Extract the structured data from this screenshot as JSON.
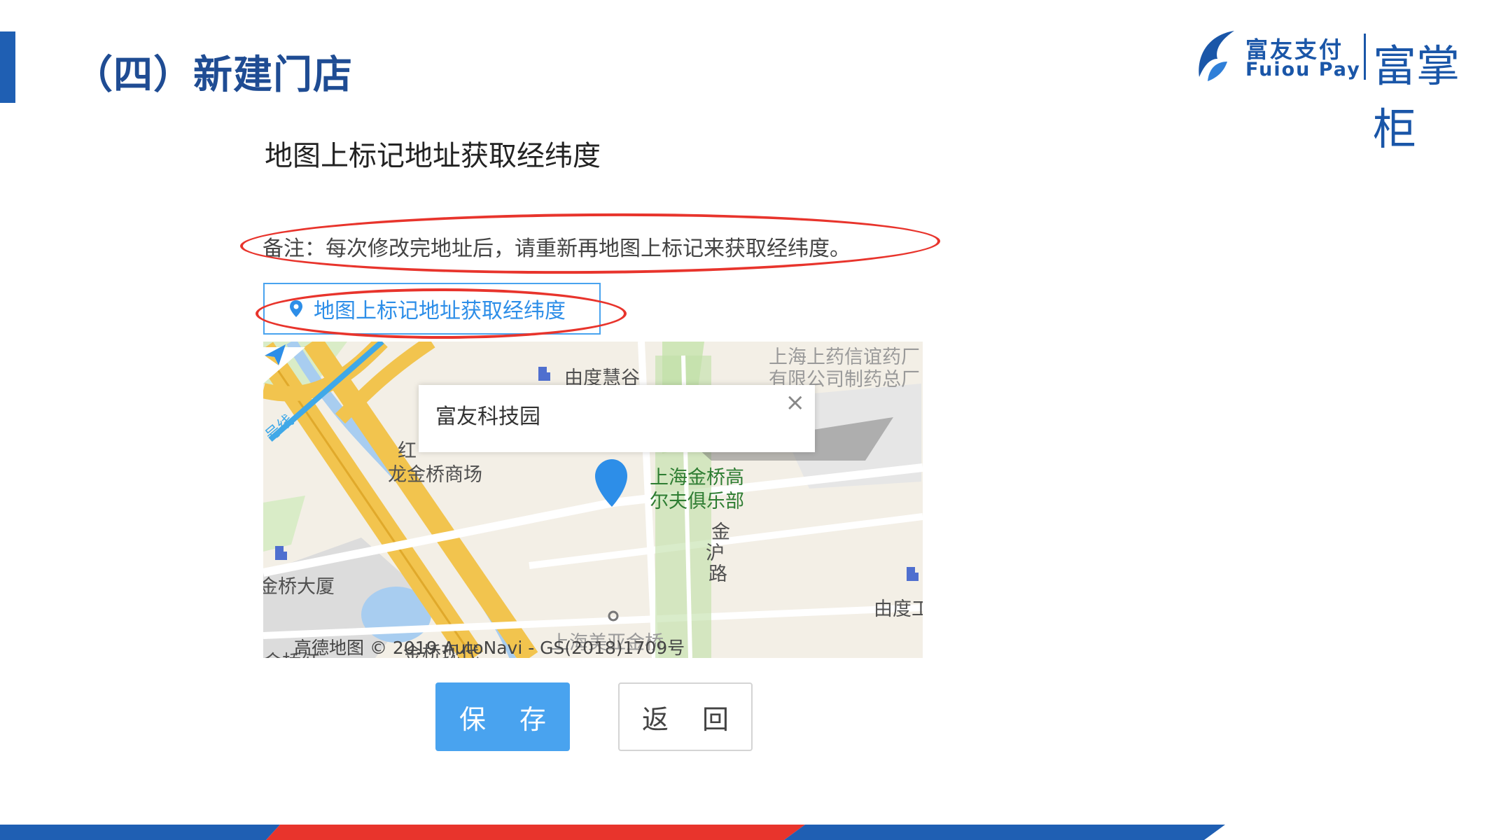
{
  "header": {
    "page_title": "（四）新建门店",
    "logo_cn": "富友支付",
    "logo_en": "Fuiou Pay",
    "logo_brand": "富掌柜"
  },
  "content": {
    "subtitle": "地图上标记地址获取经纬度",
    "note": "备注：每次修改完地址后，请重新再地图上标记来获取经纬度。",
    "map_button_label": "地图上标记地址获取经纬度"
  },
  "map": {
    "popup_title": "富友科技园",
    "popup_close": "×",
    "labels": {
      "youdu_huigu": "由度慧谷",
      "pharma_line1": "上海上药信谊药厂",
      "pharma_line2": "有限公司制药总厂",
      "hongqiao_partial": "红",
      "longjinqiao": "龙金桥商场",
      "golf_line1": "上海金桥高",
      "golf_line2": "尔夫俱乐部",
      "jinhu_road_1": "金",
      "jinhu_road_2": "沪",
      "jinhu_road_3": "路",
      "jinqiao_building": "金桥大厦",
      "youdu_right": "由度工",
      "metro_line": "号线",
      "bottom_faint": "上海美亚金桥",
      "bottom_left": "金桥红",
      "bottom_mid": "金桥现代"
    },
    "copyright": "高德地图 © 2019 AutoNavi - GS(2018)1709号"
  },
  "actions": {
    "save": "保 存",
    "back": "返 回"
  },
  "colors": {
    "title_blue": "#1f4c93",
    "accent_blue": "#49a3ef",
    "highlight_red": "#e8342c"
  }
}
